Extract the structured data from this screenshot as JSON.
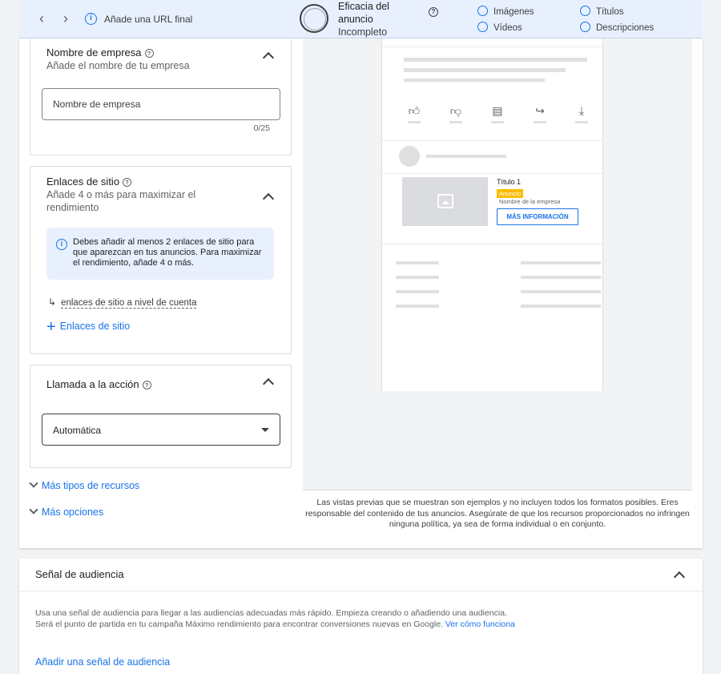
{
  "topbar": {
    "url_hint": "Añade una URL final",
    "strength_title": "Eficacia del anuncio",
    "strength_status": "Incompleto",
    "checklist": [
      "Imágenes",
      "Títulos",
      "Vídeos",
      "Descripciones"
    ]
  },
  "business_name": {
    "title": "Nombre de empresa",
    "subtitle": "Añade el nombre de tu empresa",
    "placeholder": "Nombre de empresa",
    "counter": "0/25"
  },
  "sitelinks": {
    "title": "Enlaces de sitio",
    "subtitle": "Añade 4 o más para maximizar el rendimiento",
    "notice": "Debes añadir al menos 2 enlaces de sitio para que aparezcan en tus anuncios. Para maximizar el rendimiento, añade 4 o más.",
    "account_link": "enlaces de sitio a nivel de cuenta",
    "add_label": "Enlaces de sitio"
  },
  "cta_section": {
    "title": "Llamada a la acción",
    "selected": "Automática"
  },
  "more_assets": "Más tipos de recursos",
  "more_options": "Más opciones",
  "preview": {
    "ad_title": "Título 1",
    "ad_badge": "Anuncio",
    "ad_business": "Nombre de la empresa",
    "ad_cta": "MÁS INFORMACIÓN",
    "disclaimer": "Las vistas previas que se muestran son ejemplos y no incluyen todos los formatos posibles. Eres responsable del contenido de tus anuncios. Asegúrate de que los recursos proporcionados no infringen ninguna política, ya sea de forma individual o en conjunto."
  },
  "audience": {
    "title": "Señal de audiencia",
    "description": "Usa una señal de audiencia para llegar a las audiencias adecuadas más rápido. Empieza creando o añadiendo una audiencia. Será el punto de partida en tu campaña Máximo rendimiento para encontrar conversiones nuevas en Google.",
    "learn_link": "Ver cómo funciona",
    "add_link": "Añadir una señal de audiencia"
  },
  "colors": {
    "accent": "#1a73e8",
    "topbar_bg": "#e8f0fe",
    "badge": "#fbbc04"
  }
}
